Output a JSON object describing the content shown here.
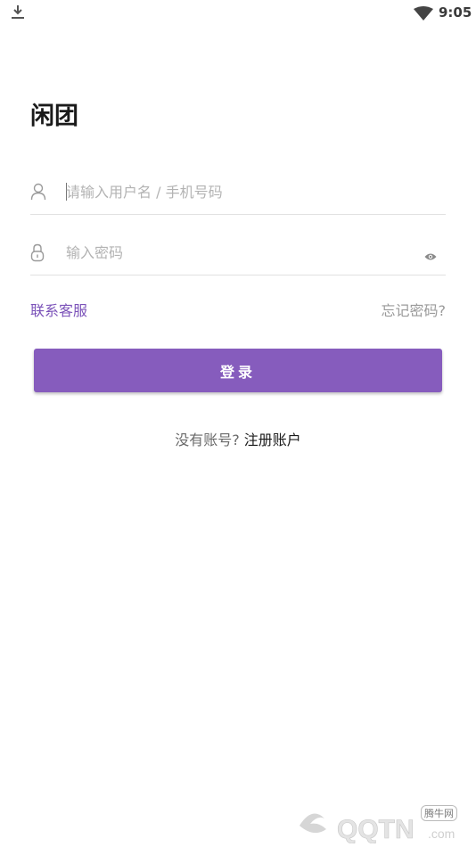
{
  "status_bar": {
    "time": "9:05"
  },
  "app": {
    "title": "闲团"
  },
  "form": {
    "username_placeholder": "请输入用户名 / 手机号码",
    "password_placeholder": "输入密码"
  },
  "links": {
    "contact": "联系客服",
    "forgot_password": "忘记密码?"
  },
  "login": {
    "label": "登录"
  },
  "register": {
    "prompt": "没有账号?",
    "link": "注册账户"
  },
  "watermark": {
    "text_cn": "腾牛网",
    "text_en": "QQTN.com"
  },
  "colors": {
    "accent": "#865cbd",
    "link": "#7b52b9"
  }
}
